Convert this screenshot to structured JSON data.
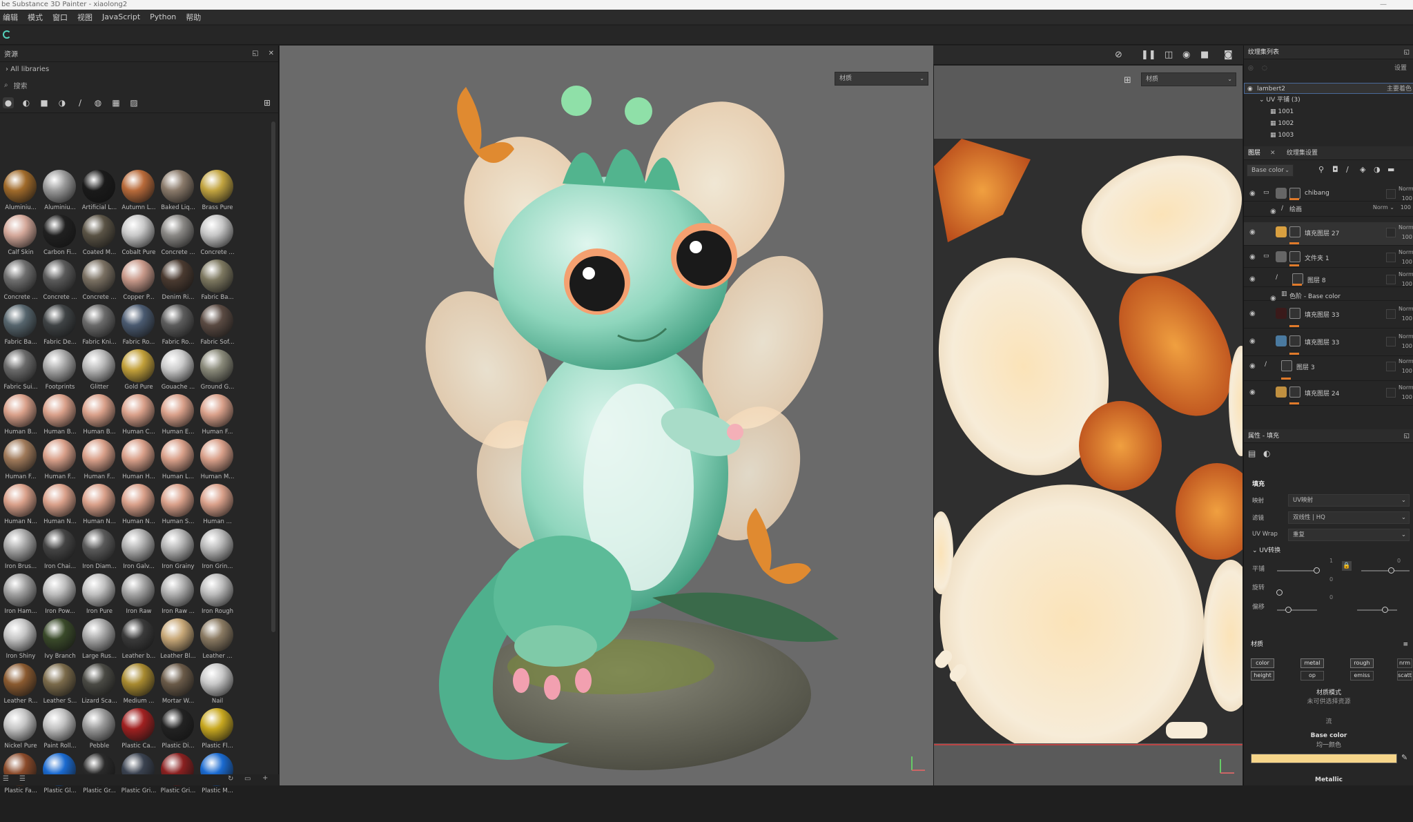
{
  "window": {
    "title": "be Substance 3D Painter - xiaolong2"
  },
  "menu": [
    "编辑",
    "模式",
    "窗口",
    "视图",
    "JavaScript",
    "Python",
    "帮助"
  ],
  "assets": {
    "title": "资源",
    "breadcrumb": "All libraries",
    "search_placeholder": "搜索",
    "materials": [
      {
        "label": "Aluminiu...",
        "color": "#a06a2a"
      },
      {
        "label": "Aluminiu...",
        "color": "#9a9a9a"
      },
      {
        "label": "Artificial L...",
        "color": "#1a1a1a"
      },
      {
        "label": "Autumn L...",
        "color": "#b86a3a"
      },
      {
        "label": "Baked Liq...",
        "color": "#8a7a6a"
      },
      {
        "label": "Brass Pure",
        "color": "#c2a440"
      },
      {
        "label": "Calf Skin",
        "color": "#d4a89a"
      },
      {
        "label": "Carbon Fi...",
        "color": "#202020"
      },
      {
        "label": "Coated M...",
        "color": "#5a5345"
      },
      {
        "label": "Cobalt Pure",
        "color": "#c8c8c8"
      },
      {
        "label": "Concrete ...",
        "color": "#8a8885"
      },
      {
        "label": "Concrete ...",
        "color": "#c6c6c6"
      },
      {
        "label": "Concrete ...",
        "color": "#6e6e6e"
      },
      {
        "label": "Concrete ...",
        "color": "#5a5a5a"
      },
      {
        "label": "Concrete ...",
        "color": "#7a7062"
      },
      {
        "label": "Copper P...",
        "color": "#c8998a"
      },
      {
        "label": "Denim Ri...",
        "color": "#4a3a30"
      },
      {
        "label": "Fabric Ba...",
        "color": "#7d7860"
      },
      {
        "label": "Fabric Ba...",
        "color": "#56656d"
      },
      {
        "label": "Fabric De...",
        "color": "#3f4345"
      },
      {
        "label": "Fabric Kni...",
        "color": "#6a6a6a"
      },
      {
        "label": "Fabric Ro...",
        "color": "#4a5a70"
      },
      {
        "label": "Fabric Ro...",
        "color": "#5c5c5c"
      },
      {
        "label": "Fabric Sof...",
        "color": "#5a4a42"
      },
      {
        "label": "Fabric Sui...",
        "color": "#6a6a6a"
      },
      {
        "label": "Footprints",
        "color": "#a8a8a8"
      },
      {
        "label": "Glitter",
        "color": "#b8b8b8"
      },
      {
        "label": "Gold Pure",
        "color": "#c2a03a"
      },
      {
        "label": "Gouache ...",
        "color": "#cacaca"
      },
      {
        "label": "Ground G...",
        "color": "#8a8a7a"
      },
      {
        "label": "Human B...",
        "color": "#d9a08a"
      },
      {
        "label": "Human B...",
        "color": "#d9a08a"
      },
      {
        "label": "Human B...",
        "color": "#d9a08a"
      },
      {
        "label": "Human C...",
        "color": "#d9a08a"
      },
      {
        "label": "Human E...",
        "color": "#d9a08a"
      },
      {
        "label": "Human F...",
        "color": "#d9a08a"
      },
      {
        "label": "Human F...",
        "color": "#a07a5a"
      },
      {
        "label": "Human F...",
        "color": "#d9a08a"
      },
      {
        "label": "Human F...",
        "color": "#d9a08a"
      },
      {
        "label": "Human H...",
        "color": "#d9a08a"
      },
      {
        "label": "Human L...",
        "color": "#d9a08a"
      },
      {
        "label": "Human M...",
        "color": "#d9a08a"
      },
      {
        "label": "Human N...",
        "color": "#d9a08a"
      },
      {
        "label": "Human N...",
        "color": "#d9a08a"
      },
      {
        "label": "Human N...",
        "color": "#d9a08a"
      },
      {
        "label": "Human N...",
        "color": "#d9a08a"
      },
      {
        "label": "Human S...",
        "color": "#d9a08a"
      },
      {
        "label": "Human ...",
        "color": "#d9a08a"
      },
      {
        "label": "Iron Brus...",
        "color": "#a8a8a8"
      },
      {
        "label": "Iron Chai...",
        "color": "#444444"
      },
      {
        "label": "Iron Diam...",
        "color": "#5a5a5a"
      },
      {
        "label": "Iron Galv...",
        "color": "#b0b0b0"
      },
      {
        "label": "Iron Grainy",
        "color": "#b4b4b4"
      },
      {
        "label": "Iron Grin...",
        "color": "#b8b8b8"
      },
      {
        "label": "Iron Ham...",
        "color": "#a0a0a0"
      },
      {
        "label": "Iron Pow...",
        "color": "#bdbdbd"
      },
      {
        "label": "Iron Pure",
        "color": "#c0c0c0"
      },
      {
        "label": "Iron Raw",
        "color": "#a4a4a4"
      },
      {
        "label": "Iron Raw ...",
        "color": "#b0b0b0"
      },
      {
        "label": "Iron Rough",
        "color": "#bcbcbc"
      },
      {
        "label": "Iron Shiny",
        "color": "#c4c4c4"
      },
      {
        "label": "Ivy Branch",
        "color": "#3a4a2a"
      },
      {
        "label": "Large Rus...",
        "color": "#a8a8a8"
      },
      {
        "label": "Leather b...",
        "color": "#3a3a3a"
      },
      {
        "label": "Leather Bl...",
        "color": "#c8a878"
      },
      {
        "label": "Leather ...",
        "color": "#8a7a62"
      },
      {
        "label": "Leather R...",
        "color": "#8a5a30"
      },
      {
        "label": "Leather S...",
        "color": "#7a6a4a"
      },
      {
        "label": "Lizard Sca...",
        "color": "#4a4a44"
      },
      {
        "label": "Medium ...",
        "color": "#a88a30"
      },
      {
        "label": "Mortar W...",
        "color": "#6a5a48"
      },
      {
        "label": "Nail",
        "color": "#c8c8c8"
      },
      {
        "label": "Nickel Pure",
        "color": "#c4c4c4"
      },
      {
        "label": "Paint Roll...",
        "color": "#c0c0c0"
      },
      {
        "label": "Pebble",
        "color": "#9a9a9a"
      },
      {
        "label": "Plastic Ca...",
        "color": "#a02020"
      },
      {
        "label": "Plastic Di...",
        "color": "#222222"
      },
      {
        "label": "Plastic Fl...",
        "color": "#c8a820"
      },
      {
        "label": "Plastic Fa...",
        "color": "#8a4a2a"
      },
      {
        "label": "Plastic Gl...",
        "color": "#1a6ad0"
      },
      {
        "label": "Plastic Gr...",
        "color": "#2a2a2a"
      },
      {
        "label": "Plastic Gri...",
        "color": "#3a4250"
      },
      {
        "label": "Plastic Gri...",
        "color": "#8a2020"
      },
      {
        "label": "Plastic M...",
        "color": "#1a6ad0"
      }
    ]
  },
  "viewport3d": {
    "material_select": "材质"
  },
  "viewport2d": {
    "material_select": "材质"
  },
  "texture_sets": {
    "title": "纹理集列表",
    "settings": "设置",
    "set_name": "lambert2",
    "shader": "主要着色",
    "uv_label": "UV 平铺 (3)",
    "tiles": [
      "1001",
      "1002",
      "1003"
    ]
  },
  "layers": {
    "tabs": [
      "图层",
      "纹理集设置"
    ],
    "channel": "Base color",
    "items": [
      {
        "name": "chibang",
        "type": "folder",
        "blend": "Norm",
        "opacity": "100",
        "thumb": "#666666"
      },
      {
        "name": "绘画",
        "type": "sub",
        "blend": "Norm",
        "opacity": "100"
      },
      {
        "name": "填充图层 27",
        "type": "fill",
        "blend": "Norm",
        "opacity": "100",
        "thumb": "#d9a040"
      },
      {
        "name": "文件夹 1",
        "type": "folder",
        "blend": "Norm",
        "opacity": "100",
        "thumb": "#666666"
      },
      {
        "name": "图层 8",
        "type": "paint",
        "blend": "Norm",
        "opacity": "100"
      },
      {
        "name": "色阶 - Base color",
        "type": "effect"
      },
      {
        "name": "填充图层 33",
        "type": "fill",
        "blend": "Norm",
        "opacity": "100",
        "thumb": "#3a1a1a"
      },
      {
        "name": "填充图层 33",
        "type": "fill",
        "blend": "Norm",
        "opacity": "100",
        "thumb": "#4a7aa0"
      },
      {
        "name": "图层 3",
        "type": "paint",
        "blend": "Norm",
        "opacity": "100"
      },
      {
        "name": "填充图层 24",
        "type": "fill",
        "blend": "Norm",
        "opacity": "100",
        "thumb": "#c09040"
      }
    ]
  },
  "properties": {
    "title": "属性 - 填充",
    "fill_label": "填充",
    "projection_label": "映射",
    "projection_value": "UV映射",
    "filter_label": "滤镜",
    "filter_value": "双线性 | HQ",
    "uvwrap_label": "UV Wrap",
    "uvwrap_value": "重复",
    "uvtransform_label": "UV转换",
    "scale_label": "平铺",
    "scale_value": "1",
    "rotation_label": "旋转",
    "offset_label": "偏移",
    "rot_value": "0",
    "offset_value": "0",
    "scale_right": "0",
    "material_label": "材质",
    "channels": [
      "color",
      "metal",
      "rough",
      "nrm",
      "height",
      "op",
      "emiss",
      "scatt"
    ],
    "material_mode": "材质模式",
    "no_resource": "未可供选择资源",
    "stream_label": "流",
    "base_color": "Base color",
    "uniform": "均一颜色",
    "base_color_value": "#f6d58a",
    "metallic": "Metallic"
  }
}
